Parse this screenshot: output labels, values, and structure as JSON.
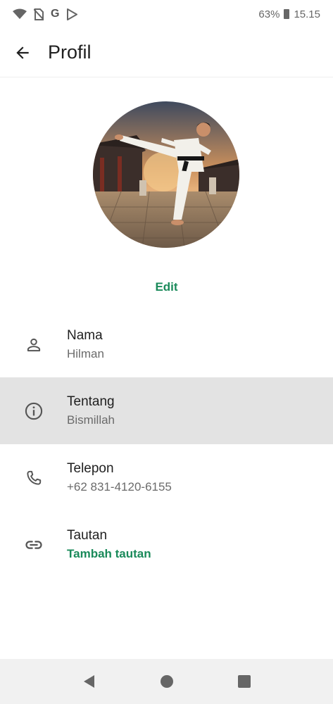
{
  "status_bar": {
    "g_label": "G",
    "battery": "63%",
    "time": "15.15"
  },
  "header": {
    "title": "Profil"
  },
  "profile": {
    "edit_label": "Edit"
  },
  "rows": [
    {
      "label": "Nama",
      "value": "Hilman",
      "icon": "person-icon"
    },
    {
      "label": "Tentang",
      "value": "Bismillah",
      "icon": "info-icon"
    },
    {
      "label": "Telepon",
      "value": "+62 831-4120-6155",
      "icon": "phone-icon"
    },
    {
      "label": "Tautan",
      "value": "Tambah tautan",
      "icon": "link-icon"
    }
  ],
  "colors": {
    "accent": "#1a8a5a",
    "highlight_row": "#e3e3e3"
  }
}
